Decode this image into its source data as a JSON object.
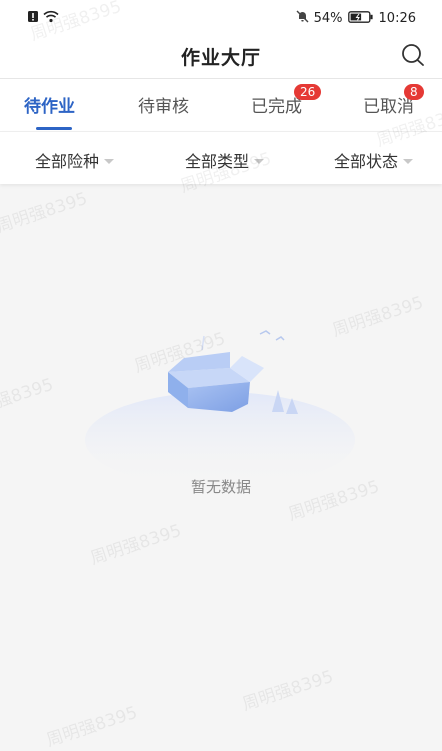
{
  "status_bar": {
    "battery": "54%",
    "time": "10:26"
  },
  "header": {
    "title": "作业大厅"
  },
  "tabs": [
    {
      "label": "待作业",
      "badge": ""
    },
    {
      "label": "待审核",
      "badge": ""
    },
    {
      "label": "已完成",
      "badge": "26"
    },
    {
      "label": "已取消",
      "badge": "8"
    }
  ],
  "filters": [
    {
      "label": "全部险种"
    },
    {
      "label": "全部类型"
    },
    {
      "label": "全部状态"
    }
  ],
  "empty": {
    "text": "暂无数据"
  },
  "watermark": "周明强8395",
  "colors": {
    "accent": "#2d64c5",
    "badge": "#e53935"
  }
}
